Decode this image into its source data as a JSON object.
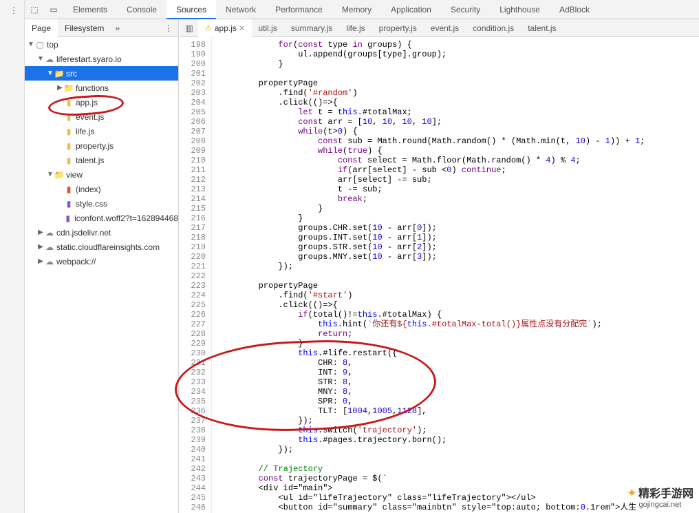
{
  "toolbar": {
    "select_icon": "⟀",
    "device_icon": "▭"
  },
  "panels": [
    "Elements",
    "Console",
    "Sources",
    "Network",
    "Performance",
    "Memory",
    "Application",
    "Security",
    "Lighthouse",
    "AdBlock"
  ],
  "active_panel": 2,
  "subtabs": [
    "Page",
    "Filesystem"
  ],
  "active_subtab": 0,
  "tree": [
    {
      "d": 0,
      "tw": "▼",
      "ico": "frame",
      "label": "top",
      "sel": false
    },
    {
      "d": 1,
      "tw": "▼",
      "ico": "cloud",
      "label": "liferestart.syaro.io",
      "sel": false
    },
    {
      "d": 2,
      "tw": "▼",
      "ico": "folder-blue",
      "label": "src",
      "sel": true
    },
    {
      "d": 3,
      "tw": "▶",
      "ico": "folder-blue",
      "label": "functions",
      "sel": false
    },
    {
      "d": 3,
      "tw": "",
      "ico": "js",
      "label": "app.js",
      "sel": false
    },
    {
      "d": 3,
      "tw": "",
      "ico": "js",
      "label": "event.js",
      "sel": false
    },
    {
      "d": 3,
      "tw": "",
      "ico": "js",
      "label": "life.js",
      "sel": false
    },
    {
      "d": 3,
      "tw": "",
      "ico": "js",
      "label": "property.js",
      "sel": false
    },
    {
      "d": 3,
      "tw": "",
      "ico": "js",
      "label": "talent.js",
      "sel": false
    },
    {
      "d": 2,
      "tw": "▼",
      "ico": "folder-blue",
      "label": "view",
      "sel": false
    },
    {
      "d": 3,
      "tw": "",
      "ico": "html",
      "label": "(index)",
      "sel": false
    },
    {
      "d": 3,
      "tw": "",
      "ico": "css",
      "label": "style.css",
      "sel": false
    },
    {
      "d": 3,
      "tw": "",
      "ico": "font",
      "label": "iconfont.woff2?t=162894468",
      "sel": false
    },
    {
      "d": 1,
      "tw": "▶",
      "ico": "cloud",
      "label": "cdn.jsdelivr.net",
      "sel": false
    },
    {
      "d": 1,
      "tw": "▶",
      "ico": "cloud",
      "label": "static.cloudflareinsights.com",
      "sel": false
    },
    {
      "d": 1,
      "tw": "▶",
      "ico": "cloud",
      "label": "webpack://",
      "sel": false
    }
  ],
  "editor_tabs": [
    {
      "label": "app.js",
      "active": true,
      "warn": true,
      "close": true
    },
    {
      "label": "util.js"
    },
    {
      "label": "summary.js"
    },
    {
      "label": "life.js"
    },
    {
      "label": "property.js"
    },
    {
      "label": "event.js"
    },
    {
      "label": "condition.js"
    },
    {
      "label": "talent.js"
    }
  ],
  "first_line_no": 198,
  "code_lines": [
    "            for(const type in groups) {",
    "                ul.append(groups[type].group);",
    "            }",
    "",
    "        propertyPage",
    "            .find('#random')",
    "            .click(()=>{",
    "                let t = this.#totalMax;",
    "                const arr = [10, 10, 10, 10];",
    "                while(t>0) {",
    "                    const sub = Math.round(Math.random() * (Math.min(t, 10) - 1)) + 1;",
    "                    while(true) {",
    "                        const select = Math.floor(Math.random() * 4) % 4;",
    "                        if(arr[select] - sub <0) continue;",
    "                        arr[select] -= sub;",
    "                        t -= sub;",
    "                        break;",
    "                    }",
    "                }",
    "                groups.CHR.set(10 - arr[0]);",
    "                groups.INT.set(10 - arr[1]);",
    "                groups.STR.set(10 - arr[2]);",
    "                groups.MNY.set(10 - arr[3]);",
    "            });",
    "",
    "        propertyPage",
    "            .find('#start')",
    "            .click(()=>{",
    "                if(total()!=this.#totalMax) {",
    "                    this.hint(`你还有${this.#totalMax-total()}属性点没有分配完`);",
    "                    return;",
    "                }",
    "                this.#life.restart({",
    "                    CHR: 8,",
    "                    INT: 9,",
    "                    STR: 8,",
    "                    MNY: 8,",
    "                    SPR: 0,",
    "                    TLT: [1004,1005,1128],",
    "                });",
    "                this.switch('trajectory');",
    "                this.#pages.trajectory.born();",
    "            });",
    "",
    "        // Trajectory",
    "        const trajectoryPage = $(`",
    "        <div id=\"main\">",
    "            <ul id=\"lifeTrajectory\" class=\"lifeTrajectory\"></ul>",
    "            <button id=\"summary\" class=\"mainbtn\" style=\"top:auto; bottom:0.1rem\">人生"
  ],
  "watermark": {
    "brand": "精彩手游网",
    "url": "gojingcai.net"
  }
}
